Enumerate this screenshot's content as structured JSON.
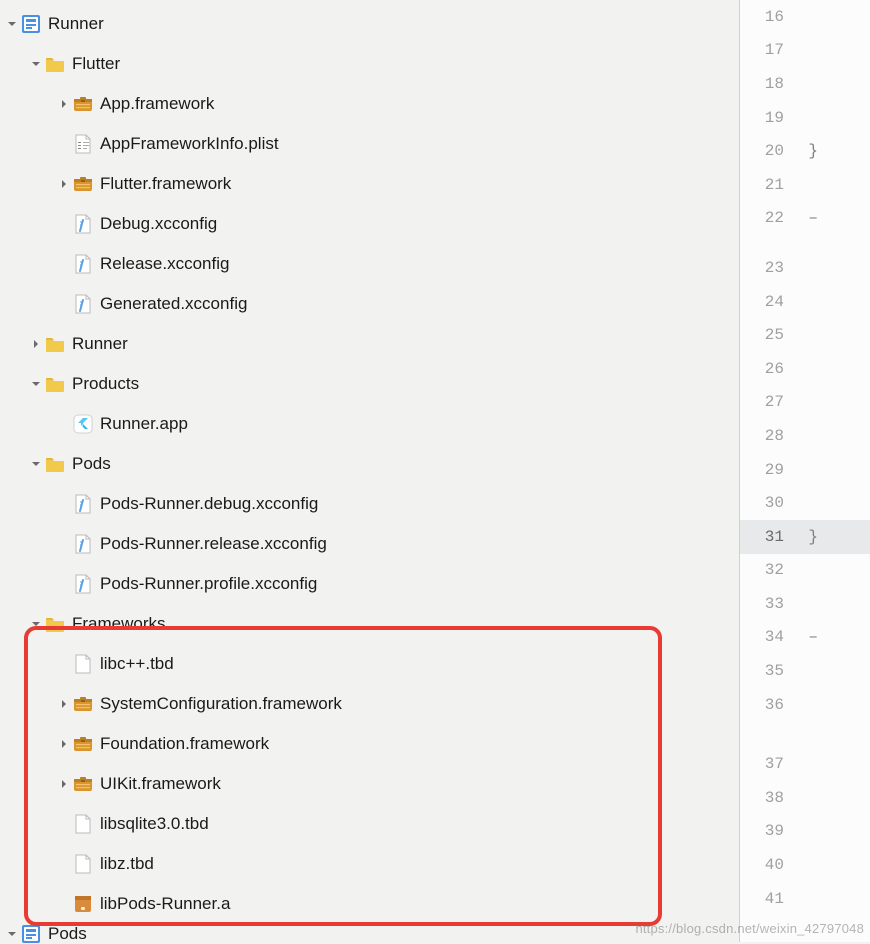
{
  "tree": [
    {
      "indent": 0,
      "expand": "down",
      "icon": "project",
      "label": "Runner"
    },
    {
      "indent": 1,
      "expand": "down",
      "icon": "folder",
      "label": "Flutter"
    },
    {
      "indent": 2,
      "expand": "right",
      "icon": "framework",
      "label": "App.framework"
    },
    {
      "indent": 2,
      "expand": "none",
      "icon": "plist",
      "label": "AppFrameworkInfo.plist"
    },
    {
      "indent": 2,
      "expand": "right",
      "icon": "framework",
      "label": "Flutter.framework"
    },
    {
      "indent": 2,
      "expand": "none",
      "icon": "config",
      "label": "Debug.xcconfig"
    },
    {
      "indent": 2,
      "expand": "none",
      "icon": "config",
      "label": "Release.xcconfig"
    },
    {
      "indent": 2,
      "expand": "none",
      "icon": "config",
      "label": "Generated.xcconfig"
    },
    {
      "indent": 1,
      "expand": "right",
      "icon": "folder",
      "label": "Runner"
    },
    {
      "indent": 1,
      "expand": "down",
      "icon": "folder",
      "label": "Products"
    },
    {
      "indent": 2,
      "expand": "none",
      "icon": "app",
      "label": "Runner.app"
    },
    {
      "indent": 1,
      "expand": "down",
      "icon": "folder",
      "label": "Pods"
    },
    {
      "indent": 2,
      "expand": "none",
      "icon": "config",
      "label": "Pods-Runner.debug.xcconfig"
    },
    {
      "indent": 2,
      "expand": "none",
      "icon": "config",
      "label": "Pods-Runner.release.xcconfig"
    },
    {
      "indent": 2,
      "expand": "none",
      "icon": "config",
      "label": "Pods-Runner.profile.xcconfig"
    },
    {
      "indent": 1,
      "expand": "down",
      "icon": "folder",
      "label": "Frameworks"
    },
    {
      "indent": 2,
      "expand": "none",
      "icon": "blank",
      "label": "libc++.tbd"
    },
    {
      "indent": 2,
      "expand": "right",
      "icon": "framework",
      "label": "SystemConfiguration.framework"
    },
    {
      "indent": 2,
      "expand": "right",
      "icon": "framework",
      "label": "Foundation.framework"
    },
    {
      "indent": 2,
      "expand": "right",
      "icon": "framework",
      "label": "UIKit.framework"
    },
    {
      "indent": 2,
      "expand": "none",
      "icon": "blank",
      "label": "libsqlite3.0.tbd"
    },
    {
      "indent": 2,
      "expand": "none",
      "icon": "blank",
      "label": "libz.tbd"
    },
    {
      "indent": 2,
      "expand": "none",
      "icon": "archive",
      "label": "libPods-Runner.a"
    },
    {
      "indent": 0,
      "expand": "down",
      "icon": "project",
      "label": "Pods",
      "partial": true
    }
  ],
  "editor_lines": [
    {
      "num": 16,
      "ch": ""
    },
    {
      "num": 17,
      "ch": ""
    },
    {
      "num": 18,
      "ch": ""
    },
    {
      "num": 19,
      "ch": ""
    },
    {
      "num": 20,
      "ch": "}"
    },
    {
      "num": 21,
      "ch": ""
    },
    {
      "num": 22,
      "ch": "–"
    },
    {
      "num": 23,
      "ch": ""
    },
    {
      "num": 24,
      "ch": ""
    },
    {
      "num": 25,
      "ch": ""
    },
    {
      "num": 26,
      "ch": ""
    },
    {
      "num": 27,
      "ch": ""
    },
    {
      "num": 28,
      "ch": ""
    },
    {
      "num": 29,
      "ch": ""
    },
    {
      "num": 30,
      "ch": ""
    },
    {
      "num": 31,
      "ch": "}",
      "active": true
    },
    {
      "num": 32,
      "ch": ""
    },
    {
      "num": 33,
      "ch": ""
    },
    {
      "num": 34,
      "ch": "–"
    },
    {
      "num": 35,
      "ch": ""
    },
    {
      "num": 36,
      "ch": ""
    },
    {
      "num": 37,
      "ch": ""
    },
    {
      "num": 38,
      "ch": ""
    },
    {
      "num": 39,
      "ch": ""
    },
    {
      "num": 40,
      "ch": ""
    },
    {
      "num": 41,
      "ch": ""
    }
  ],
  "watermark": "https://blog.csdn.net/weixin_42797048"
}
